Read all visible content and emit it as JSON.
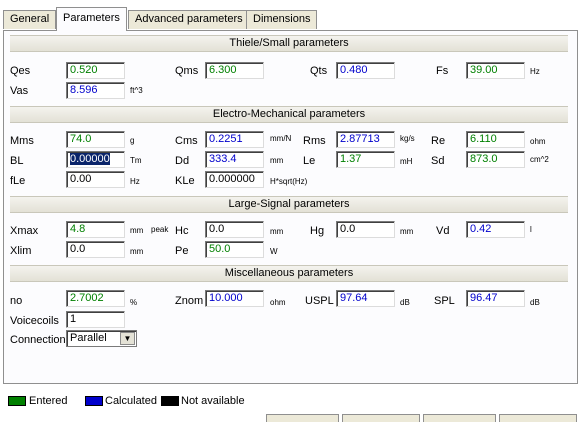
{
  "tabs": [
    "General",
    "Parameters",
    "Advanced parameters",
    "Dimensions"
  ],
  "sections": {
    "ts": "Thiele/Small parameters",
    "em": "Electro-Mechanical parameters",
    "ls": "Large-Signal parameters",
    "misc": "Miscellaneous parameters"
  },
  "ts": {
    "qes": {
      "label": "Qes",
      "value": "0.520"
    },
    "qms": {
      "label": "Qms",
      "value": "6.300"
    },
    "qts": {
      "label": "Qts",
      "value": "0.480"
    },
    "fs": {
      "label": "Fs",
      "value": "39.00",
      "unit": "Hz"
    },
    "vas": {
      "label": "Vas",
      "value": "8.596",
      "unit": "ft^3"
    }
  },
  "em": {
    "mms": {
      "label": "Mms",
      "value": "74.0",
      "unit": "g"
    },
    "cms": {
      "label": "Cms",
      "value": "0.2251",
      "unit": "mm/N"
    },
    "rms": {
      "label": "Rms",
      "value": "2.87713",
      "unit": "kg/s"
    },
    "re": {
      "label": "Re",
      "value": "6.110",
      "unit": "ohm"
    },
    "bl": {
      "label": "BL",
      "value": "0.00000",
      "unit": "Tm"
    },
    "dd": {
      "label": "Dd",
      "value": "333.4",
      "unit": "mm"
    },
    "le": {
      "label": "Le",
      "value": "1.37",
      "unit": "mH"
    },
    "sd": {
      "label": "Sd",
      "value": "873.0",
      "unit": "cm^2"
    },
    "fle": {
      "label": "fLe",
      "value": "0.00",
      "unit": "Hz"
    },
    "kle": {
      "label": "KLe",
      "value": "0.000000",
      "unit": "H*sqrt(Hz)"
    }
  },
  "ls": {
    "xmax": {
      "label": "Xmax",
      "value": "4.8",
      "unit": "mm",
      "unit2": "peak"
    },
    "hc": {
      "label": "Hc",
      "value": "0.0",
      "unit": "mm"
    },
    "hg": {
      "label": "Hg",
      "value": "0.0",
      "unit": "mm"
    },
    "vd": {
      "label": "Vd",
      "value": "0.42",
      "unit": "l"
    },
    "xlim": {
      "label": "Xlim",
      "value": "0.0",
      "unit": "mm"
    },
    "pe": {
      "label": "Pe",
      "value": "50.0",
      "unit": "W"
    }
  },
  "misc": {
    "no": {
      "label": "no",
      "value": "2.7002",
      "unit": "%"
    },
    "znom": {
      "label": "Znom",
      "value": "10.000",
      "unit": "ohm"
    },
    "uspl": {
      "label": "USPL",
      "value": "97.64",
      "unit": "dB"
    },
    "spl": {
      "label": "SPL",
      "value": "96.47",
      "unit": "dB"
    },
    "voicecoils": {
      "label": "Voicecoils",
      "value": "1"
    },
    "connection": {
      "label": "Connection",
      "value": "Parallel"
    }
  },
  "legend": {
    "entered": {
      "label": "Entered",
      "color": "#008000"
    },
    "calculated": {
      "label": "Calculated",
      "color": "#0000cc"
    },
    "na": {
      "label": "Not available",
      "color": "#000000"
    }
  }
}
